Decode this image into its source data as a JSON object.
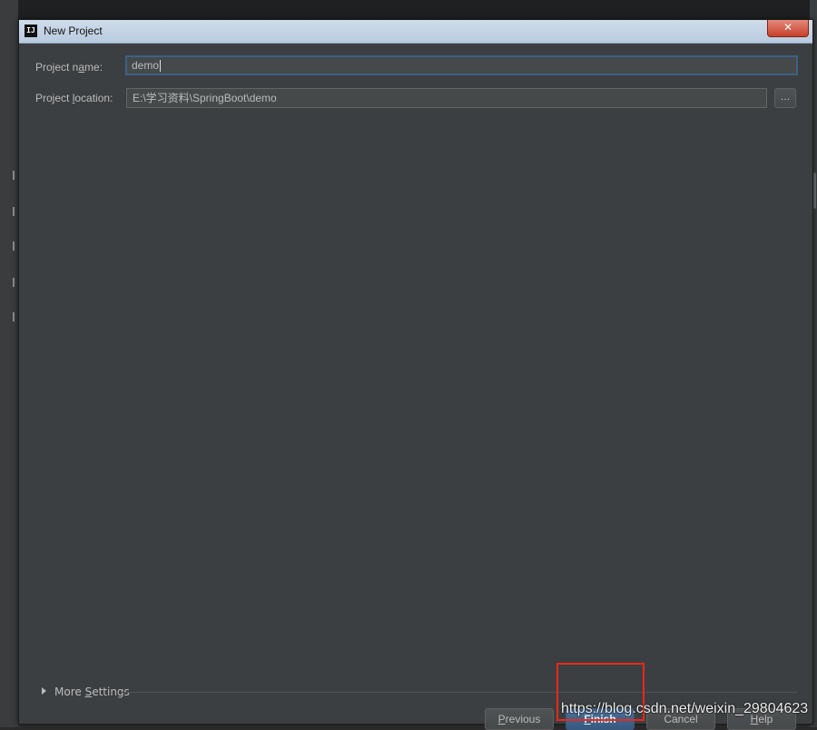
{
  "window": {
    "title": "New Project",
    "app_icon_text": "IJ",
    "close_glyph": "✕"
  },
  "form": {
    "project_name": {
      "label_pre": "Project n",
      "label_mnemonic": "a",
      "label_post": "me:",
      "value": "demo"
    },
    "project_location": {
      "label_pre": "Project ",
      "label_mnemonic": "l",
      "label_post": "ocation:",
      "value": "E:\\学习资料\\SpringBoot\\demo",
      "browse_label": "..."
    }
  },
  "more_settings": {
    "label_pre": "More ",
    "label_mnemonic": "S",
    "label_post": "ettings"
  },
  "buttons": {
    "previous": {
      "mnemonic": "P",
      "rest": "revious"
    },
    "finish": {
      "mnemonic": "F",
      "rest": "inish"
    },
    "cancel": {
      "label": "Cancel"
    },
    "help": {
      "mnemonic": "H",
      "rest": "elp"
    }
  },
  "watermark": "https://blog.csdn.net/weixin_29804623",
  "colors": {
    "dialog_bg": "#3c3f41",
    "input_bg": "#45494a",
    "focus_border": "#3d6185",
    "primary_button": "#375a7f",
    "annotation_red": "#e8291c"
  }
}
